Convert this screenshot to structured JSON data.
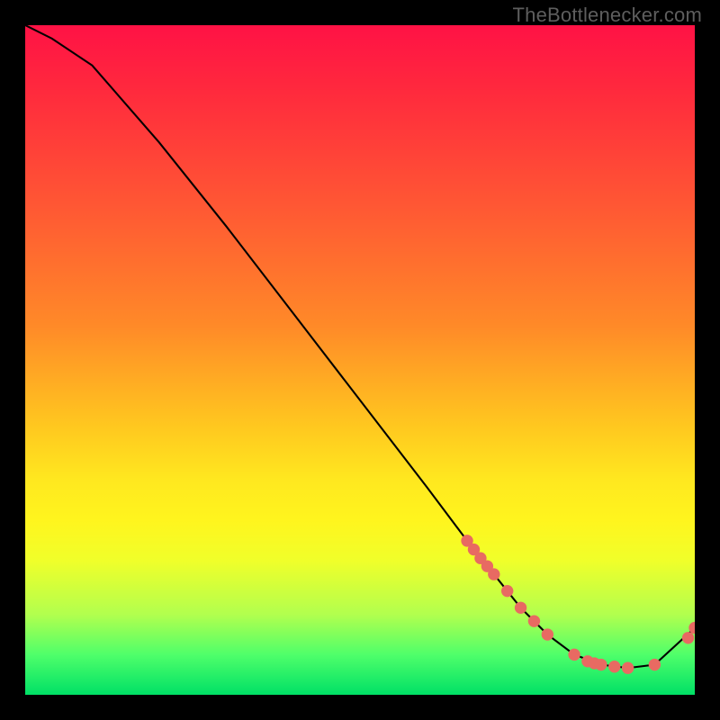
{
  "source_label": "TheBottlenecker.com",
  "chart_data": {
    "type": "line",
    "title": "",
    "xlabel": "",
    "ylabel": "",
    "xlim": [
      0,
      100
    ],
    "ylim": [
      0,
      100
    ],
    "series": [
      {
        "name": "curve",
        "x": [
          0,
          4,
          10,
          20,
          30,
          40,
          50,
          60,
          66,
          70,
          74,
          78,
          82,
          86,
          90,
          94,
          100
        ],
        "y": [
          100,
          98,
          94,
          82.5,
          70,
          57,
          44,
          31,
          23,
          18,
          13,
          9,
          6,
          4.5,
          4,
          4.5,
          10
        ]
      }
    ],
    "markers": {
      "name": "highlight-points",
      "color": "#e86a62",
      "x": [
        66,
        67,
        68,
        69,
        70,
        72,
        74,
        76,
        78,
        82,
        84,
        85,
        86,
        88,
        90,
        94,
        99,
        100
      ],
      "y": [
        23,
        21.7,
        20.4,
        19.2,
        18,
        15.5,
        13,
        11,
        9,
        6,
        5,
        4.7,
        4.5,
        4.2,
        4,
        4.5,
        8.5,
        10
      ]
    }
  }
}
